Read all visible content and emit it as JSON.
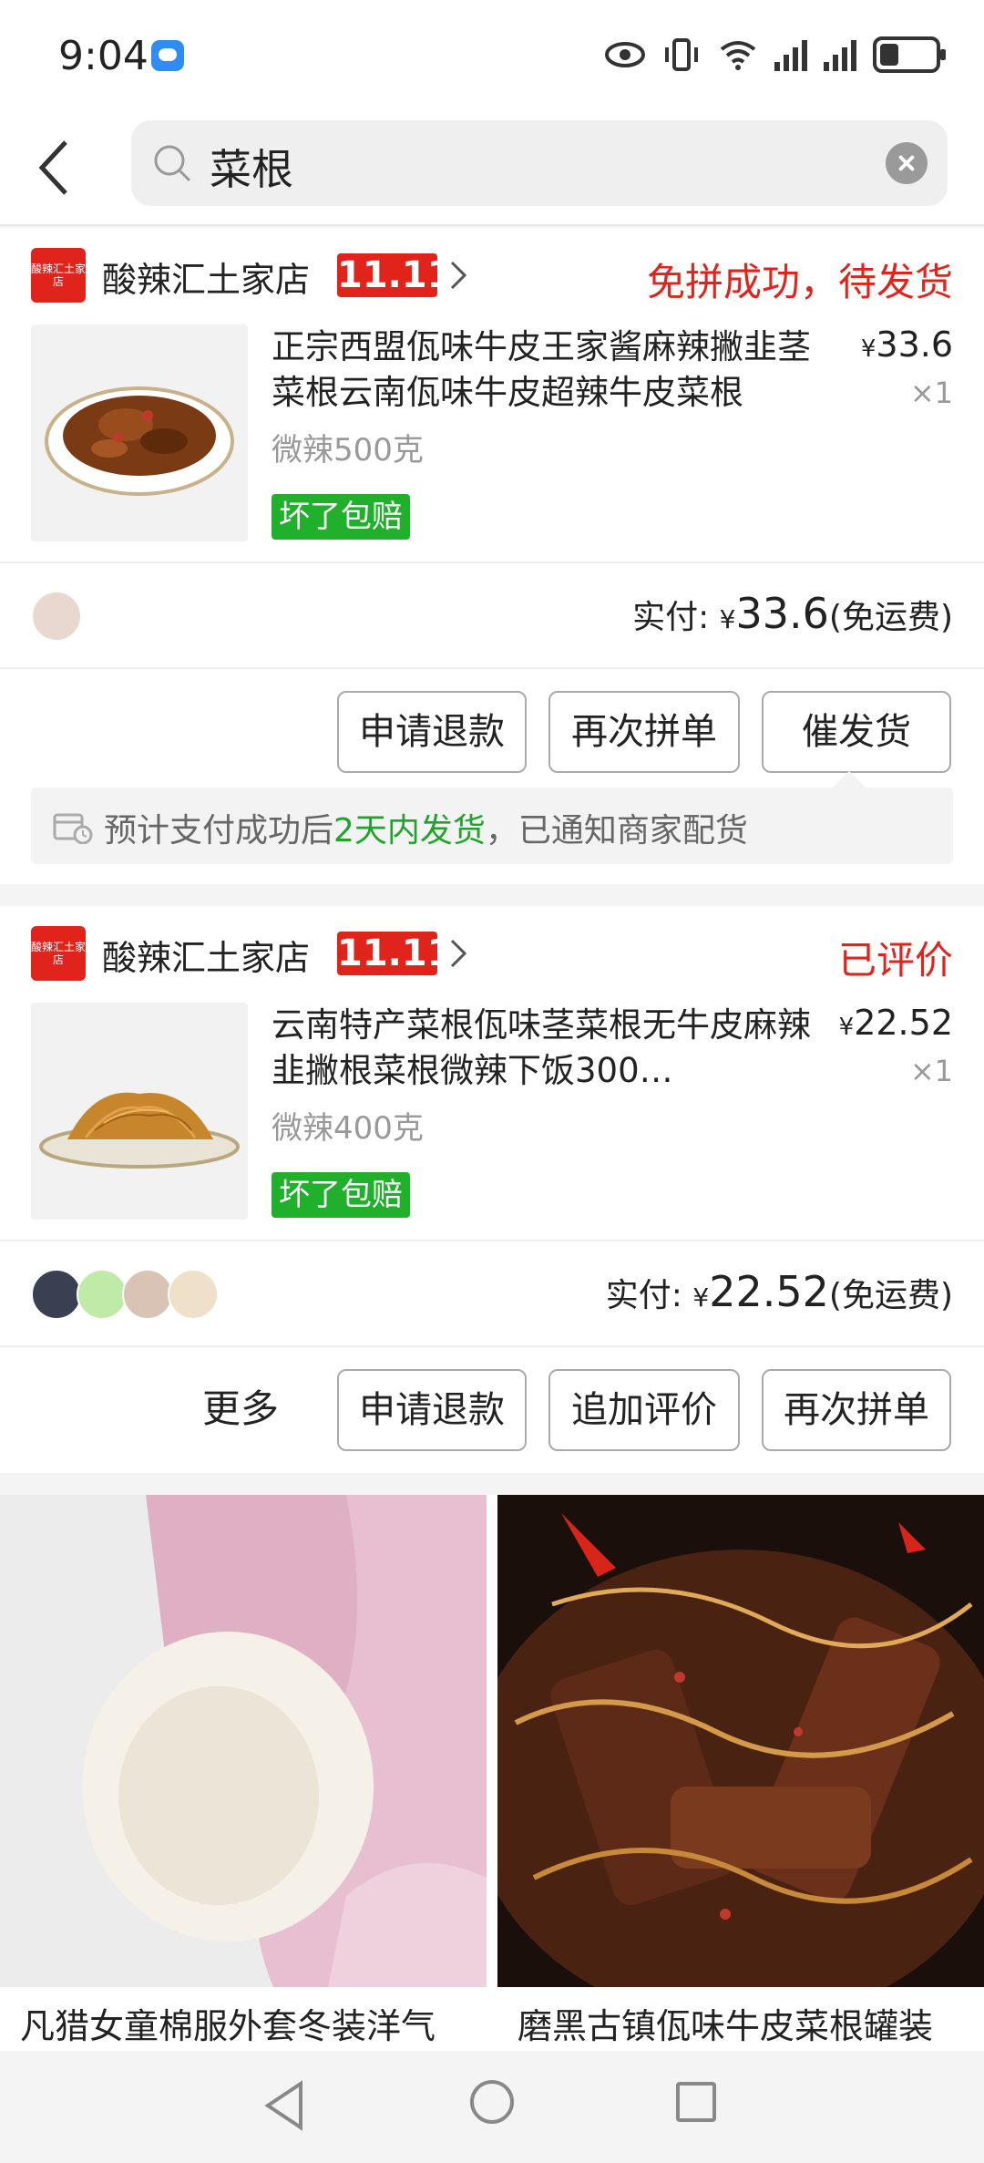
{
  "status_bar": {
    "time": "9:04"
  },
  "search": {
    "query": "菜根"
  },
  "orders": [
    {
      "shop_logo_text": "酸辣汇土家店",
      "shop_name": "酸辣汇土家店",
      "badge": "11.11",
      "status": "免拼成功，待发货",
      "product": {
        "title": "正宗西盟佤味牛皮王家酱麻辣撇韭茎菜根云南佤味牛皮超辣牛皮菜根",
        "price_symbol": "¥",
        "price": "33.6",
        "qty": "×1",
        "spec": "微辣500克",
        "tag": "坏了包赔"
      },
      "paid_label": "实付:",
      "paid_symbol": "¥",
      "paid_amount": "33.6",
      "shipping_note": "(免运费)",
      "buttons": [
        "申请退款",
        "再次拼单",
        "催发货"
      ],
      "notice": {
        "prefix": "预计支付成功后",
        "highlight": "2天内发货",
        "suffix": "，已通知商家配货"
      }
    },
    {
      "shop_logo_text": "酸辣汇土家店",
      "shop_name": "酸辣汇土家店",
      "badge": "11.11",
      "status": "已评价",
      "product": {
        "title": "云南特产菜根佤味茎菜根无牛皮麻辣韭撇根菜根微辣下饭300…",
        "price_symbol": "¥",
        "price": "22.52",
        "qty": "×1",
        "spec": "微辣400克",
        "tag": "坏了包赔"
      },
      "paid_label": "实付:",
      "paid_symbol": "¥",
      "paid_amount": "22.52",
      "shipping_note": "(免运费)",
      "more_label": "更多",
      "buttons": [
        "申请退款",
        "追加评价",
        "再次拼单"
      ]
    }
  ],
  "recommendations": [
    {
      "title": "凡猎女童棉服外套冬装洋气"
    },
    {
      "title": "磨黑古镇佤味牛皮菜根罐装"
    }
  ],
  "colors": {
    "accent_red": "#e0231b",
    "green_tag": "#20b02c",
    "green_text": "#20a32a"
  }
}
